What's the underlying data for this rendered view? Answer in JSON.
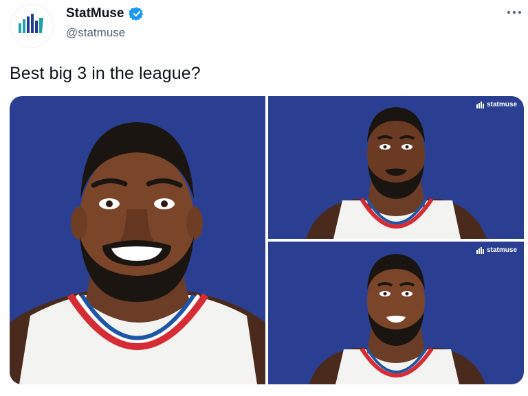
{
  "account": {
    "display_name": "StatMuse",
    "handle": "@statmuse",
    "avatar_icon": "statmuse-logo-icon",
    "verified": true
  },
  "tweet": {
    "text": "Best big 3 in the league?"
  },
  "media": {
    "watermark": "statmuse",
    "background_color": "#2b3f92",
    "panels": [
      {
        "position": "left",
        "subject": "player-illustration",
        "watermark_visible": false
      },
      {
        "position": "top-right",
        "subject": "player-illustration",
        "watermark_visible": true
      },
      {
        "position": "bottom-right",
        "subject": "player-illustration",
        "watermark_visible": true
      }
    ]
  },
  "colors": {
    "text": "#0f1419",
    "secondary_text": "#536471",
    "verified_blue": "#1d9bf0",
    "brand_teal": "#1fa3a8",
    "brand_navy": "#1f3e8f"
  }
}
